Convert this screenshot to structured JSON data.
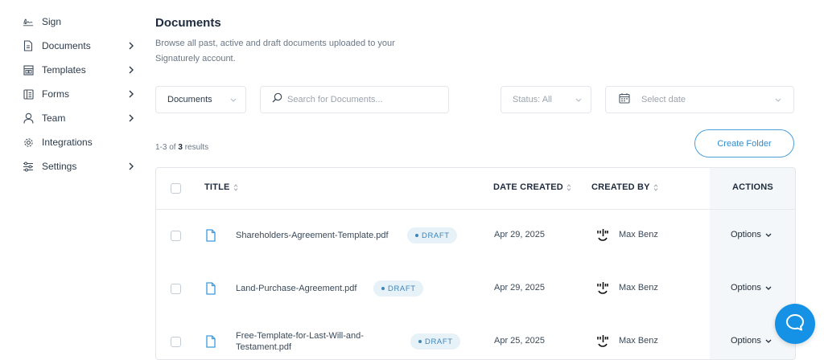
{
  "sidebar": {
    "items": [
      {
        "label": "Sign",
        "icon": "signature-icon",
        "has_chevron": false
      },
      {
        "label": "Documents",
        "icon": "document-icon",
        "has_chevron": true
      },
      {
        "label": "Templates",
        "icon": "templates-icon",
        "has_chevron": true
      },
      {
        "label": "Forms",
        "icon": "forms-icon",
        "has_chevron": true
      },
      {
        "label": "Team",
        "icon": "user-icon",
        "has_chevron": true
      },
      {
        "label": "Integrations",
        "icon": "gear-icon",
        "has_chevron": false
      },
      {
        "label": "Settings",
        "icon": "sliders-icon",
        "has_chevron": true
      }
    ]
  },
  "header": {
    "title": "Documents",
    "description": "Browse all past, active and draft documents uploaded to your Signaturely account."
  },
  "filters": {
    "type_value": "Documents",
    "search_placeholder": "Search for Documents...",
    "status_value": "Status: All",
    "date_placeholder": "Select date"
  },
  "results": {
    "prefix": "1-3 of",
    "count": "3",
    "suffix": "results"
  },
  "create_folder_label": "Create Folder",
  "table": {
    "columns": {
      "title": "TITLE",
      "date": "DATE CREATED",
      "created_by": "CREATED BY",
      "actions": "ACTIONS"
    },
    "rows": [
      {
        "title": "Shareholders-Agreement-Template.pdf",
        "status": "DRAFT",
        "date": "Apr 29, 2025",
        "created_by": "Max Benz",
        "action": "Options"
      },
      {
        "title": "Land-Purchase-Agreement.pdf",
        "status": "DRAFT",
        "date": "Apr 29, 2025",
        "created_by": "Max Benz",
        "action": "Options"
      },
      {
        "title": "Free-Template-for-Last-Will-and-Testament.pdf",
        "status": "DRAFT",
        "date": "Apr 25, 2025",
        "created_by": "Max Benz",
        "action": "Options"
      }
    ]
  },
  "colors": {
    "accent": "#1592e6",
    "badge_bg": "#e6f1f8",
    "badge_text": "#3c86b8"
  },
  "chat_icon": "chat-bubble-icon"
}
